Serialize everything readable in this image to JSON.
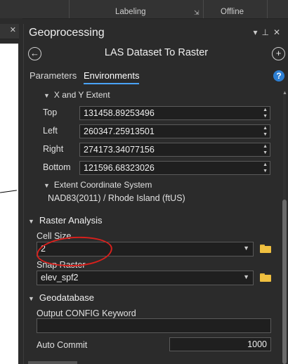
{
  "ribbon": {
    "labeling_label": "Labeling",
    "offline_label": "Offline"
  },
  "pane": {
    "title": "Geoprocessing",
    "tool_title": "LAS Dataset To Raster",
    "tabs": [
      {
        "label": "Parameters"
      },
      {
        "label": "Environments"
      }
    ]
  },
  "xy_extent": {
    "label": "X and Y Extent",
    "top_label": "Top",
    "top_value": "131458.89253496",
    "left_label": "Left",
    "left_value": "260347.25913501",
    "right_label": "Right",
    "right_value": "274173.34077156",
    "bottom_label": "Bottom",
    "bottom_value": "121596.68323026",
    "coord_sys_label": "Extent Coordinate System",
    "coord_sys_value": "NAD83(2011) / Rhode Island (ftUS)"
  },
  "raster_analysis": {
    "label": "Raster Analysis",
    "cell_size_label": "Cell Size",
    "cell_size_value": "2",
    "snap_raster_label": "Snap Raster",
    "snap_raster_value": "elev_spf2"
  },
  "geodatabase": {
    "label": "Geodatabase",
    "config_keyword_label": "Output CONFIG Keyword",
    "config_keyword_value": "",
    "auto_commit_label": "Auto Commit",
    "auto_commit_value": "1000"
  },
  "icons": {
    "back": "back-arrow-icon",
    "add": "add-icon",
    "help": "help-icon",
    "folder": "folder-icon"
  },
  "colors": {
    "accent": "#4aa3ff",
    "annotation": "#d8201c",
    "folder": "#f0c040"
  }
}
